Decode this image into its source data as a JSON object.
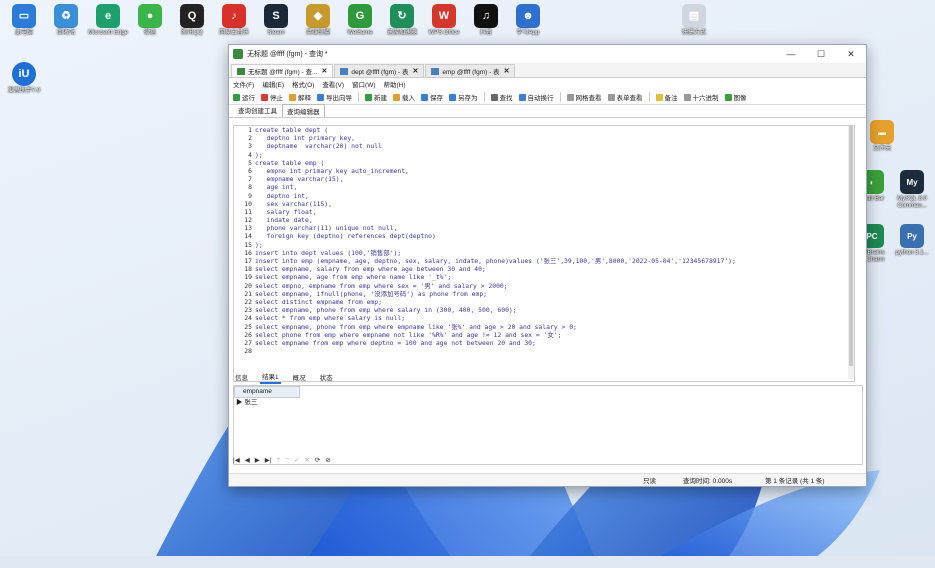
{
  "desktop": {
    "icons_left": [
      {
        "label": "此电脑",
        "color": "#2b7bd8",
        "glyph": "▭"
      },
      {
        "label": "回收站",
        "color": "#3a8fd9",
        "glyph": "♻"
      },
      {
        "label": "Microsoft Edge",
        "color": "#1e9f6e",
        "glyph": "e"
      },
      {
        "label": "微信",
        "color": "#3ab54a",
        "glyph": "●"
      },
      {
        "label": "腾讯QQ",
        "color": "#222222",
        "glyph": "Q"
      },
      {
        "label": "网易云音乐",
        "color": "#d9302a",
        "glyph": "♪"
      },
      {
        "label": "Steam",
        "color": "#1b2838",
        "glyph": "S"
      },
      {
        "label": "英雄联盟",
        "color": "#c79a2e",
        "glyph": "◆"
      },
      {
        "label": "WeGame",
        "color": "#2f9a3c",
        "glyph": "G"
      },
      {
        "label": "迅游加速器",
        "color": "#1f8f5a",
        "glyph": "↻"
      },
      {
        "label": "WPS Office",
        "color": "#d6352a",
        "glyph": "W"
      },
      {
        "label": "抖音",
        "color": "#111111",
        "glyph": "♫"
      },
      {
        "label": "学习App",
        "color": "#2f6fd0",
        "glyph": "☻"
      },
      {
        "label": "快捷方式",
        "color": "#cfd6df",
        "glyph": "▤"
      }
    ],
    "icon_row2": {
      "label": "爱思助手7.0",
      "color": "#1e6fd9",
      "glyph": "iU"
    },
    "icons_right": [
      {
        "label": "文件夹",
        "color": "#e6a12a",
        "glyph": "▬"
      },
      {
        "label": "Snail Bar",
        "color": "#3aa13a",
        "glyph": "◐"
      },
      {
        "label": "MySQL 8.0 Comman...",
        "color": "#1d2c3c",
        "glyph": "My"
      },
      {
        "label": "JetBrains PyCharm",
        "color": "#1e8a52",
        "glyph": "PC"
      },
      {
        "label": "python 3.1...",
        "color": "#3a6fb0",
        "glyph": "Py"
      }
    ]
  },
  "window": {
    "title": "无标题 @ffff (fgm) - 查询 *",
    "controls": [
      "—",
      "☐",
      "✕"
    ],
    "tabs": [
      {
        "label": "无标题 @ffff (fgm) - 查...",
        "close": "✕",
        "active": true
      },
      {
        "label": "dept @ffff (fgm) - 表",
        "close": "✕",
        "active": false
      },
      {
        "label": "emp @ffff (fgm) - 表",
        "close": "✕",
        "active": false
      }
    ],
    "menu": [
      "文件(F)",
      "编辑(E)",
      "格式(O)",
      "查看(V)",
      "窗口(W)",
      "帮助(H)"
    ],
    "toolbar": [
      {
        "label": "运行",
        "color": "#2e9e3e"
      },
      {
        "label": "停止",
        "color": "#d63b3b"
      },
      {
        "label": "解释",
        "color": "#e0a030"
      },
      {
        "label": "导出向导",
        "color": "#3b7ed6"
      },
      {
        "label": "新建",
        "color": "#2e9e3e"
      },
      {
        "label": "载入",
        "color": "#e0a030"
      },
      {
        "label": "保存",
        "color": "#3b7ed6"
      },
      {
        "label": "另存为",
        "color": "#3b7ed6"
      },
      {
        "label": "查找",
        "color": "#666666"
      },
      {
        "label": "自动换行",
        "color": "#3b7ed6"
      },
      {
        "label": "网格查看",
        "color": "#999999"
      },
      {
        "label": "表单查看",
        "color": "#999999"
      },
      {
        "label": "备注",
        "color": "#e0c030"
      },
      {
        "label": "十六进制",
        "color": "#999999"
      },
      {
        "label": "图像",
        "color": "#3aa13a"
      }
    ],
    "subtabs": [
      "查询创建工具",
      "查询编辑器"
    ],
    "code_lines": [
      "create table dept (",
      "   deptno int primary key,",
      "   deptname  varchar(20) not null",
      ");",
      "create table emp (",
      "   empno int primary key auto_increment,",
      "   empname varchar(15),",
      "   age int,",
      "   deptno int,",
      "   sex varchar(115),",
      "   salary float,",
      "   indate date,",
      "   phone varchar(11) unique not null,",
      "   foreign key (deptno) references dept(deptno)",
      ");",
      "insert into dept values (100,'销售部');",
      "insert into emp (empname, age, deptno, sex, salary, indate, phone)values ('张三',39,100,'男',8000,'2022-05-04','12345678917');",
      "select empname, salary from emp where age between 30 and 40;",
      "select empname, age from emp where name like '_t%';",
      "select empno, empname from emp where sex = '男' and salary > 2000;",
      "select empname, ifnull(phone, '没添加号码') as phone from emp;",
      "select distinct empname from emp;",
      "select empname, phone from emp where salary in (300, 400, 500, 600);",
      "select * from emp where salary is null;",
      "select empname, phone from emp where empname like '张%' and age > 20 and salary > 0;",
      "select phone from emp where empname not like '%R%' and age != 12 and sex = '女';",
      "select empname from emp where deptno = 100 and age not between 20 and 30;",
      ""
    ],
    "result_tabs": [
      "信息",
      "结果1",
      "概况",
      "状态"
    ],
    "grid": {
      "header": "empname",
      "rows": [
        "张三"
      ]
    },
    "nav": [
      "|◀",
      "◀",
      "▶",
      "▶|",
      "+",
      "−",
      "✓",
      "✕",
      "⟳",
      "⊘"
    ],
    "status": {
      "mode": "只读",
      "time": "查询时间: 0.000s",
      "records": "第 1 条记录 (共 1 条)"
    }
  }
}
